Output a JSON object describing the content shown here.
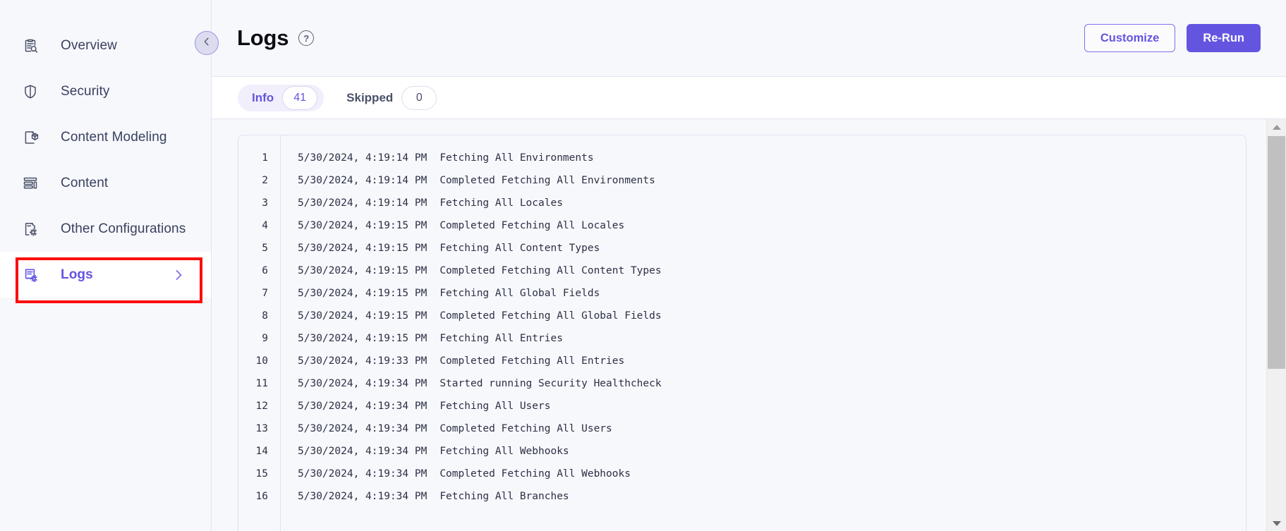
{
  "theme": {
    "accent": "#6355e0",
    "accent_light": "#f1effc",
    "page_bg": "#f7f8fc",
    "border": "#dfe3f0",
    "highlight_red": "#fb0d0d",
    "text_dark": "#2b3045"
  },
  "sidebar": {
    "items": [
      {
        "label": "Overview",
        "icon": "clipboard-search-icon",
        "active": false
      },
      {
        "label": "Security",
        "icon": "shield-icon",
        "active": false
      },
      {
        "label": "Content Modeling",
        "icon": "document-cube-icon",
        "active": false
      },
      {
        "label": "Content",
        "icon": "layout-list-icon",
        "active": false
      },
      {
        "label": "Other Configurations",
        "icon": "document-gear-icon",
        "active": false
      },
      {
        "label": "Logs",
        "icon": "document-log-gear-icon",
        "active": true
      }
    ]
  },
  "header": {
    "back_label": "Back",
    "title": "Logs",
    "help_label": "?",
    "customize_label": "Customize",
    "rerun_label": "Re-Run"
  },
  "tabs": [
    {
      "label": "Info",
      "badge": "41",
      "active": true
    },
    {
      "label": "Skipped",
      "badge": "0",
      "active": false
    }
  ],
  "logs": {
    "rows": [
      {
        "num": "1",
        "time": "5/30/2024, 4:19:14 PM",
        "message": "Fetching All Environments"
      },
      {
        "num": "2",
        "time": "5/30/2024, 4:19:14 PM",
        "message": "Completed Fetching All Environments"
      },
      {
        "num": "3",
        "time": "5/30/2024, 4:19:14 PM",
        "message": "Fetching All Locales"
      },
      {
        "num": "4",
        "time": "5/30/2024, 4:19:15 PM",
        "message": "Completed Fetching All Locales"
      },
      {
        "num": "5",
        "time": "5/30/2024, 4:19:15 PM",
        "message": "Fetching All Content Types"
      },
      {
        "num": "6",
        "time": "5/30/2024, 4:19:15 PM",
        "message": "Completed Fetching All Content Types"
      },
      {
        "num": "7",
        "time": "5/30/2024, 4:19:15 PM",
        "message": "Fetching All Global Fields"
      },
      {
        "num": "8",
        "time": "5/30/2024, 4:19:15 PM",
        "message": "Completed Fetching All Global Fields"
      },
      {
        "num": "9",
        "time": "5/30/2024, 4:19:15 PM",
        "message": "Fetching All Entries"
      },
      {
        "num": "10",
        "time": "5/30/2024, 4:19:33 PM",
        "message": "Completed Fetching All Entries"
      },
      {
        "num": "11",
        "time": "5/30/2024, 4:19:34 PM",
        "message": "Started running Security Healthcheck"
      },
      {
        "num": "12",
        "time": "5/30/2024, 4:19:34 PM",
        "message": "Fetching All Users"
      },
      {
        "num": "13",
        "time": "5/30/2024, 4:19:34 PM",
        "message": "Completed Fetching All Users"
      },
      {
        "num": "14",
        "time": "5/30/2024, 4:19:34 PM",
        "message": "Fetching All Webhooks"
      },
      {
        "num": "15",
        "time": "5/30/2024, 4:19:34 PM",
        "message": "Completed Fetching All Webhooks"
      },
      {
        "num": "16",
        "time": "5/30/2024, 4:19:34 PM",
        "message": "Fetching All Branches"
      }
    ]
  }
}
